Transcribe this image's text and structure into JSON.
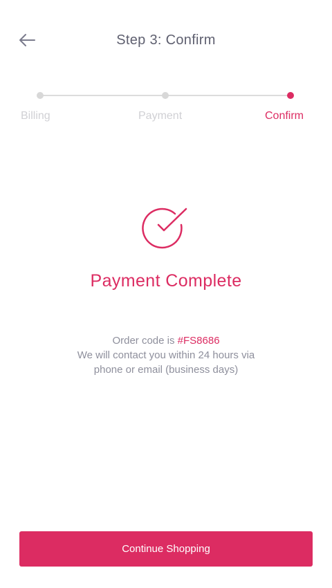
{
  "header": {
    "title": "Step 3: Confirm",
    "back_icon": "arrow-left-icon"
  },
  "stepper": {
    "steps": [
      {
        "label": "Billing",
        "state": "done"
      },
      {
        "label": "Payment",
        "state": "done"
      },
      {
        "label": "Confirm",
        "state": "active"
      }
    ]
  },
  "result": {
    "icon": "check-circle-icon",
    "headline": "Payment Complete",
    "order_prefix": "Order code is ",
    "order_code": "#FS8686",
    "line2": "We will contact you within 24 hours via",
    "line3": "phone or email (business days)"
  },
  "footer": {
    "button_label": "Continue Shopping"
  },
  "colors": {
    "accent": "#dc2c62",
    "muted": "#8e8f9c",
    "inactive": "#d8d8d8"
  }
}
